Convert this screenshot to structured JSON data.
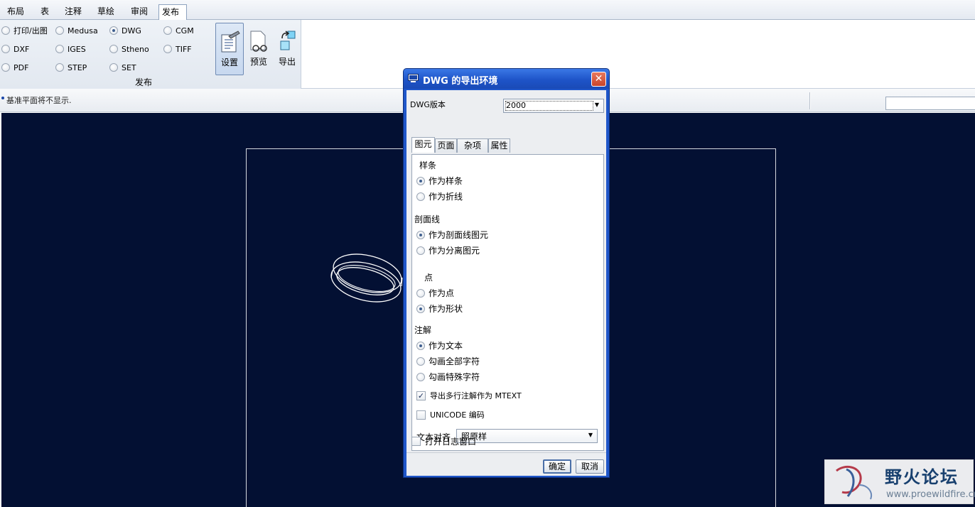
{
  "ribbon_tabs": [
    "布局",
    "表",
    "注释",
    "草绘",
    "审阅",
    "发布"
  ],
  "active_tab": "发布",
  "publish_group": {
    "formats": [
      {
        "label": "打印/出图",
        "selected": false
      },
      {
        "label": "DXF",
        "selected": false
      },
      {
        "label": "PDF",
        "selected": false
      },
      {
        "label": "Medusa",
        "selected": false
      },
      {
        "label": "IGES",
        "selected": false
      },
      {
        "label": "STEP",
        "selected": false
      },
      {
        "label": "DWG",
        "selected": true
      },
      {
        "label": "Stheno",
        "selected": false
      },
      {
        "label": "SET",
        "selected": false
      },
      {
        "label": "CGM",
        "selected": false
      },
      {
        "label": "TIFF",
        "selected": false
      }
    ],
    "group_label": "发布",
    "buttons": [
      {
        "label": "设置",
        "icon": "settings-sheet-icon",
        "selected": true
      },
      {
        "label": "预览",
        "icon": "preview-glasses-icon",
        "selected": false
      },
      {
        "label": "导出",
        "icon": "export-cubes-icon",
        "selected": false
      }
    ]
  },
  "message": "基准平面将不显示.",
  "dialog": {
    "title": "DWG 的导出环境",
    "version_label": "DWG版本",
    "version_value": "2000",
    "tabs": [
      "图元",
      "页面",
      "杂项",
      "属性"
    ],
    "active_tab": "图元",
    "sections": [
      {
        "heading": "样条",
        "options": [
          {
            "label": "作为样条",
            "selected": true
          },
          {
            "label": "作为折线",
            "selected": false
          }
        ]
      },
      {
        "heading": "剖面线",
        "options": [
          {
            "label": "作为剖面线图元",
            "selected": true
          },
          {
            "label": "作为分离图元",
            "selected": false
          }
        ]
      },
      {
        "heading": "点",
        "options": [
          {
            "label": "作为点",
            "selected": false
          },
          {
            "label": "作为形状",
            "selected": true
          }
        ]
      },
      {
        "heading": "注解",
        "options": [
          {
            "label": "作为文本",
            "selected": true
          },
          {
            "label": "勾画全部字符",
            "selected": false
          },
          {
            "label": "勾画特殊字符",
            "selected": false
          }
        ]
      }
    ],
    "mtext_checkbox": {
      "label": "导出多行注解作为 MTEXT",
      "checked": true
    },
    "unicode_checkbox": {
      "label": "UNICODE 编码",
      "checked": false
    },
    "text_align_label": "文本对齐",
    "text_align_value": "照原样",
    "log_checkbox": {
      "label": "打开日志窗口",
      "checked": false
    },
    "ok_label": "确定",
    "cancel_label": "取消"
  },
  "watermark": {
    "title": "野火论坛",
    "url": "www.proewildfire.cn"
  },
  "colors": {
    "canvas_bg": "#031033",
    "dialog_frame": "#1f56c9",
    "close_button": "#c9442a"
  }
}
